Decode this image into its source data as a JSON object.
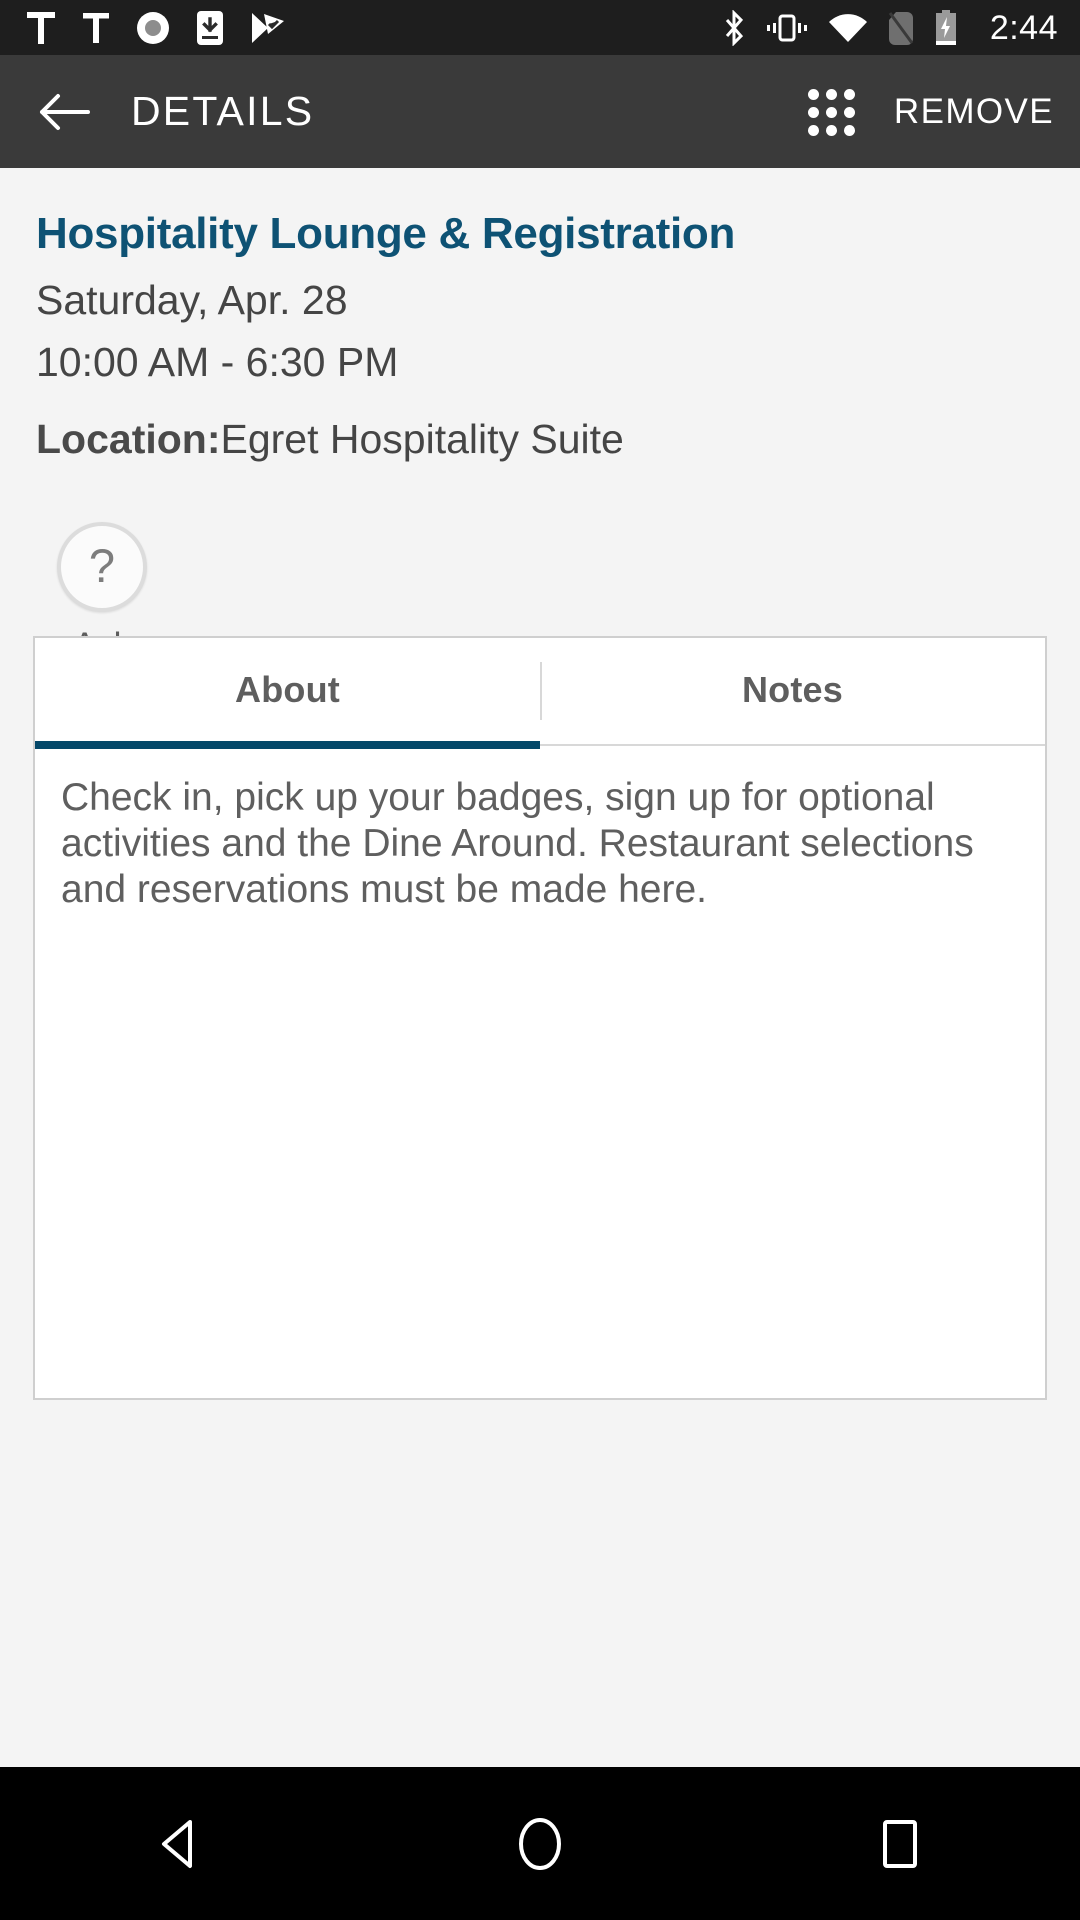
{
  "status_bar": {
    "icons": [
      "text-t-icon",
      "text-t-icon",
      "record-circle-icon",
      "app-download-icon",
      "play-protect-icon"
    ],
    "right_icons": [
      "bluetooth-icon",
      "vibrate-icon",
      "wifi-icon",
      "no-sim-icon",
      "battery-charging-icon"
    ],
    "time": "2:44"
  },
  "app_bar": {
    "back_label": "back",
    "title": "DETAILS",
    "grid_label": "apps",
    "remove_label": "REMOVE"
  },
  "event": {
    "title": "Hospitality Lounge & Registration",
    "date": "Saturday, Apr. 28",
    "time_range": "10:00 AM - 6:30 PM",
    "location_label": "Location:",
    "location_value": "Egret Hospitality Suite"
  },
  "ask": {
    "glyph": "?",
    "label": "Ask"
  },
  "tabs": [
    {
      "label": "About",
      "active": true
    },
    {
      "label": "Notes",
      "active": false
    }
  ],
  "about": {
    "body": "Check in, pick up your badges, sign up for optional activities and the Dine Around. Restaurant selections and reservations must be made here."
  },
  "nav_bar": {
    "back": "back-triangle",
    "home": "home-circle",
    "recents": "recents-square"
  },
  "colors": {
    "accent": "#0e5274",
    "tab_indicator": "#044869",
    "app_bar_bg": "#3a3a3a",
    "status_bar_bg": "#1e1e1e",
    "page_bg": "#f4f4f4"
  }
}
